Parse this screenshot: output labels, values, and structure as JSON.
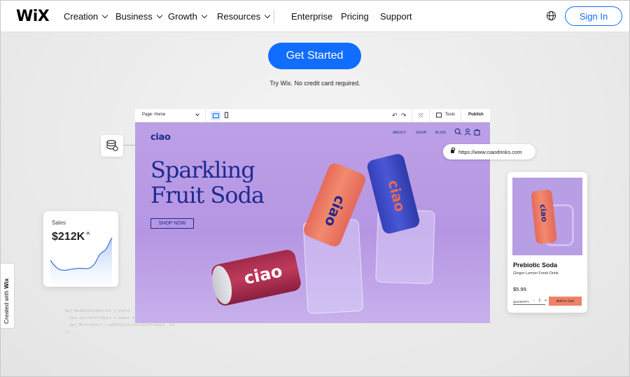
{
  "nav": {
    "logo": "WiX",
    "items": [
      {
        "label": "Creation",
        "dropdown": true
      },
      {
        "label": "Business",
        "dropdown": true
      },
      {
        "label": "Growth",
        "dropdown": true
      },
      {
        "label": "Resources",
        "dropdown": true
      },
      {
        "label": "Enterprise",
        "dropdown": false
      },
      {
        "label": "Pricing",
        "dropdown": false
      },
      {
        "label": "Support",
        "dropdown": false
      }
    ],
    "globe_icon": "globe-icon",
    "sign_in": "Sign In"
  },
  "hero": {
    "cta": "Get Started",
    "subtext": "Try Wix. No credit card required."
  },
  "editor": {
    "page_select": "Page: Home",
    "tools": "Tools",
    "publish": "Publish"
  },
  "site": {
    "logo": "ciao",
    "nav": [
      "ABOUT",
      "SHOP",
      "BLOG"
    ],
    "headline_line1": "Sparkling",
    "headline_line2": "Fruit Soda",
    "shop_now": "SHOP NOW",
    "can_text": "ciao"
  },
  "url": "https://www.ciaodrinks.com",
  "sales": {
    "label": "Sales",
    "value": "$212K"
  },
  "product": {
    "name": "Prebiotic Soda",
    "subtitle": "Ginger Lemon Fresh Drink",
    "price": "$5.99",
    "quantity_label": "QUANTITY",
    "quantity": "1",
    "add_to_cart": "Add to Cart"
  },
  "code_lines": [
    "$w('#addToCartButton').onCli",
    "  let currentProduct = await $w('",
    "  $w('#storeCart').addToCart(currentProduct._id",
    "})"
  ],
  "created_with": "Created with",
  "created_with_brand": "Wix",
  "colors": {
    "accent": "#116dff",
    "site_bg": "#b89ee4",
    "site_text": "#1d2a8f",
    "cart_btn": "#ef8266"
  }
}
